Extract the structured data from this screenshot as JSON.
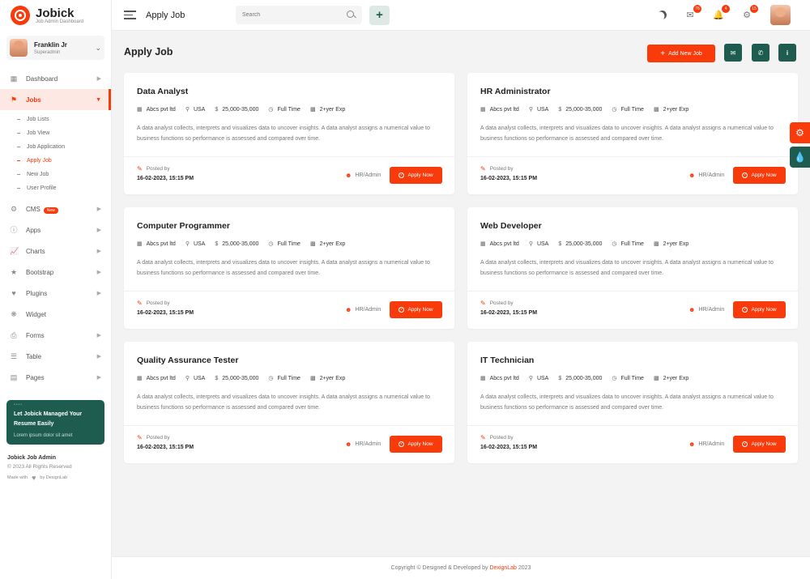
{
  "brand": {
    "name": "Jobick",
    "subtitle": "Job Admin Dashboard"
  },
  "profile": {
    "name": "Franklin Jr",
    "role": "Superadmin"
  },
  "nav": [
    {
      "label": "Dashboard",
      "icon": "grid-icon"
    },
    {
      "label": "Jobs",
      "icon": "flag-icon"
    },
    {
      "label": "CMS",
      "icon": "gear-icon",
      "badge": "New"
    },
    {
      "label": "Apps",
      "icon": "info-icon"
    },
    {
      "label": "Charts",
      "icon": "chart-icon"
    },
    {
      "label": "Bootstrap",
      "icon": "star-icon"
    },
    {
      "label": "Plugins",
      "icon": "heart-icon"
    },
    {
      "label": "Widget",
      "icon": "widget-icon"
    },
    {
      "label": "Forms",
      "icon": "printer-icon"
    },
    {
      "label": "Table",
      "icon": "table-icon"
    },
    {
      "label": "Pages",
      "icon": "pages-icon"
    }
  ],
  "jobs_sub": [
    "Job Lists",
    "Job View",
    "Job Application",
    "Apply Job",
    "New Job",
    "User Profile"
  ],
  "promo": {
    "title": "Let Jobick Managed Your Resume Easily",
    "subtitle": "Lorem ipsum dolor sit amet"
  },
  "side_footer": {
    "title": "Jobick Job Admin",
    "copyright": "© 2023 All Rights Reserved",
    "made_with": "Made with",
    "by": "by DexignLab"
  },
  "header": {
    "title": "Apply Job",
    "search_placeholder": "Search",
    "badges": {
      "messages": "76",
      "notifications": "4",
      "settings": "15"
    }
  },
  "main": {
    "title": "Apply Job",
    "add_button": "Add New Job"
  },
  "jobs": [
    {
      "title": "Data Analyst",
      "company": "Abcs pvt ltd",
      "location": "USA",
      "salary": "25,000-35,000",
      "type": "Full Time",
      "exp": "2+yer Exp",
      "desc": "A data analyst collects, interprets and visualizes data to uncover insights. A data analyst assigns a numerical value to business functions so performance is assessed and compared over time.",
      "posted_label": "Posted by",
      "date": "16-02-2023, 15:15 PM",
      "poster": "HR/Admin",
      "apply": "Apply Now"
    },
    {
      "title": "HR Administrator",
      "company": "Abcs pvt ltd",
      "location": "USA",
      "salary": "25,000-35,000",
      "type": "Full Time",
      "exp": "2+yer Exp",
      "desc": "A data analyst collects, interprets and visualizes data to uncover insights. A data analyst assigns a numerical value to business functions so performance is assessed and compared over time.",
      "posted_label": "Posted by",
      "date": "16-02-2023, 15:15 PM",
      "poster": "HR/Admin",
      "apply": "Apply Now"
    },
    {
      "title": "Computer Programmer",
      "company": "Abcs pvt ltd",
      "location": "USA",
      "salary": "25,000-35,000",
      "type": "Full Time",
      "exp": "2+yer Exp",
      "desc": "A data analyst collects, interprets and visualizes data to uncover insights. A data analyst assigns a numerical value to business functions so performance is assessed and compared over time.",
      "posted_label": "Posted by",
      "date": "16-02-2023, 15:15 PM",
      "poster": "HR/Admin",
      "apply": "Apply Now"
    },
    {
      "title": "Web Developer",
      "company": "Abcs pvt ltd",
      "location": "USA",
      "salary": "25,000-35,000",
      "type": "Full Time",
      "exp": "2+yer Exp",
      "desc": "A data analyst collects, interprets and visualizes data to uncover insights. A data analyst assigns a numerical value to business functions so performance is assessed and compared over time.",
      "posted_label": "Posted by",
      "date": "16-02-2023, 15:15 PM",
      "poster": "HR/Admin",
      "apply": "Apply Now"
    },
    {
      "title": "Quality Assurance Tester",
      "company": "Abcs pvt ltd",
      "location": "USA",
      "salary": "25,000-35,000",
      "type": "Full Time",
      "exp": "2+yer Exp",
      "desc": "A data analyst collects, interprets and visualizes data to uncover insights. A data analyst assigns a numerical value to business functions so performance is assessed and compared over time.",
      "posted_label": "Posted by",
      "date": "16-02-2023, 15:15 PM",
      "poster": "HR/Admin",
      "apply": "Apply Now"
    },
    {
      "title": "IT Technician",
      "company": "Abcs pvt ltd",
      "location": "USA",
      "salary": "25,000-35,000",
      "type": "Full Time",
      "exp": "2+yer Exp",
      "desc": "A data analyst collects, interprets and visualizes data to uncover insights. A data analyst assigns a numerical value to business functions so performance is assessed and compared over time.",
      "posted_label": "Posted by",
      "date": "16-02-2023, 15:15 PM",
      "poster": "HR/Admin",
      "apply": "Apply Now"
    }
  ],
  "footer": {
    "text": "Copyright © Designed & Developed by",
    "brand": "DexignLab",
    "year": "2023"
  },
  "colors": {
    "accent": "#f93a0b",
    "brand_dark": "#1e5c4f"
  }
}
